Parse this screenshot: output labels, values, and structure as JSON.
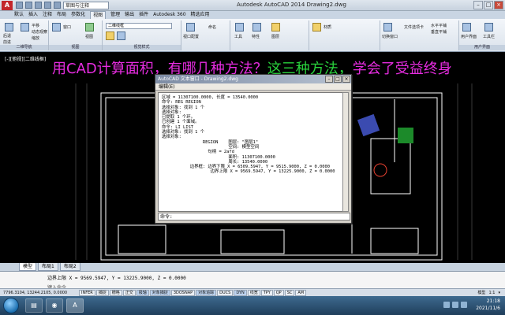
{
  "titlebar": {
    "workspace": "草图与注释",
    "title": "Autodesk AutoCAD 2014    Drawing2.dwg"
  },
  "ribbon": {
    "tabs": [
      "默认",
      "插入",
      "注释",
      "布局",
      "参数化",
      "视图",
      "管理",
      "输出",
      "插件",
      "Autodesk 360",
      "精选应用"
    ],
    "active_tab": "视图",
    "labels": {
      "back": "后退",
      "forward": "前进",
      "pan": "平移",
      "orbit": "动态观察",
      "zoom": "缩放",
      "window": "窗口",
      "view_panel": "视图",
      "visual_style": "二维线框",
      "visual_style_panel": "视觉样式",
      "viewport_config": "视口配置",
      "named": "命名",
      "tools": "工具",
      "properties": "特性",
      "layer_panel": "图层",
      "materials": "材质",
      "switch_window": "切换窗口",
      "file_tab": "文件选项卡",
      "tile_h": "水平平铺",
      "tile_v": "垂直平铺",
      "user_iface": "用户界面",
      "toolbar": "工具栏",
      "nav_panel": "二维导航",
      "ui_panel": "用户界面"
    }
  },
  "drawing": {
    "viewport_label": "[-][俯视][二维线框]",
    "headline_magenta": "用CAD计算面积，有哪几种方法？",
    "headline_green": "这三种方法，",
    "headline_magenta2": "学会了受益终身"
  },
  "cad_dialog": {
    "title": "AutoCAD 文本窗口 - Drawing2.dwg",
    "menu": "编辑(E)",
    "lines": [
      "区域 = 11307100.0000, 长度 = 13540.0000",
      "命令: REG REGION",
      "选择对象: 找到 1 个",
      "",
      "选择对象:",
      "已提取 1 个环。",
      "",
      "已创建 1 个面域。",
      "",
      "命令: LI LIST",
      "选择对象: 找到 1 个",
      "",
      "选择对象:",
      "",
      "                REGION    图层: \"图层1\"",
      "                          空间: 模型空间",
      "                  句柄 = 2afd",
      "                          面积: 11307100.0000",
      "                          周长: 13540.0000",
      "           边界框: 边界下限 X = 6509.5947, Y = 9515.9000, Z = 0.0000",
      "                   边界上限 X = 9569.5947, Y = 13225.9000, Z = 0.0000"
    ],
    "cmd_prompt": "命令:"
  },
  "layout_tabs": [
    "模型",
    "布局1",
    "布局2"
  ],
  "active_layout": "模型",
  "command_line": {
    "output": "边界上限 X = 9569.5947, Y = 13225.9000, Z = 0.0000",
    "prompt": "键入命令"
  },
  "statusbar": {
    "coords": "7796.3104, 13244.2105, 0.0000",
    "toggles": [
      "INFER",
      "捕捉",
      "栅格",
      "正交",
      "极轴",
      "对象捕捉",
      "3DOSNAP",
      "对象追踪",
      "DUCS",
      "DYN",
      "线宽",
      "TPY",
      "QP",
      "SC",
      "AM"
    ],
    "right_items": [
      "模型",
      "1:1",
      "▾"
    ]
  },
  "taskbar": {
    "time": "21:18",
    "date": "2021/11/6"
  },
  "colors": {
    "headline_magenta": "#e62ce0",
    "headline_green": "#29d23c",
    "drawing_bg": "#000000",
    "wall_color": "#ffffff"
  }
}
